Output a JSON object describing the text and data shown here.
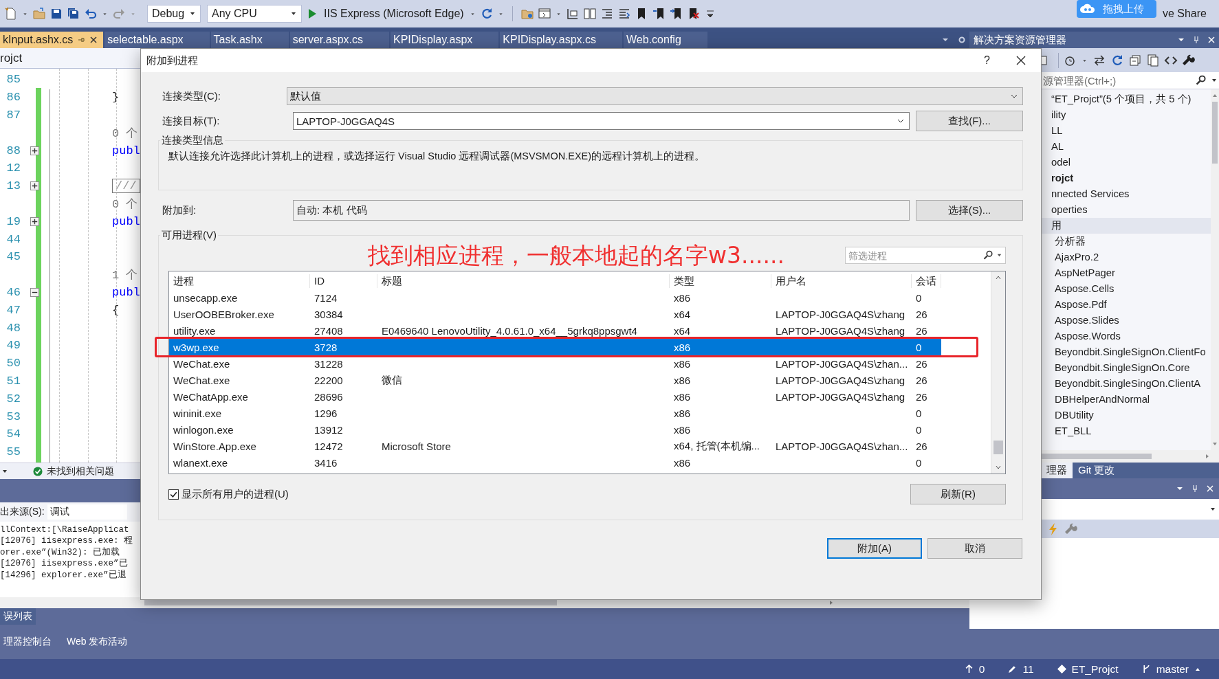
{
  "toolbar": {
    "configuration": "Debug",
    "platform": "Any CPU",
    "run_target": "IIS Express (Microsoft Edge)",
    "upload_button": "拖拽上传",
    "live_share": "ve Share"
  },
  "doc_tabs": [
    {
      "label": "kInput.ashx.cs",
      "selected": true
    },
    {
      "label": "selectable.aspx",
      "selected": false
    },
    {
      "label": "Task.ashx",
      "selected": false
    },
    {
      "label": "server.aspx.cs",
      "selected": false
    },
    {
      "label": "KPIDisplay.aspx",
      "selected": false
    },
    {
      "label": "KPIDisplay.aspx.cs",
      "selected": false
    },
    {
      "label": "Web.config",
      "selected": false
    }
  ],
  "editor": {
    "header": "rojct",
    "status": "未找到相关问题",
    "lines": [
      {
        "number": "85"
      },
      {
        "number": "86",
        "code": {
          "text": "}",
          "kind": "brace"
        }
      },
      {
        "number": "87"
      },
      {
        "code": {
          "text": "0 个",
          "kind": "lens"
        }
      },
      {
        "number": "88",
        "fold": {
          "expanded": false
        },
        "code": {
          "text": "publ",
          "kind": "keyword"
        }
      },
      {
        "number": "12"
      },
      {
        "number": "13",
        "fold": {
          "expanded": false
        },
        "code": {
          "text": "///",
          "kind": "block"
        }
      },
      {
        "code": {
          "text": "0 个",
          "kind": "lens"
        }
      },
      {
        "number": "19",
        "fold": {
          "expanded": false
        },
        "code": {
          "text": "publ",
          "kind": "keyword"
        }
      },
      {
        "number": "44"
      },
      {
        "number": "45"
      },
      {
        "code": {
          "text": "1 个",
          "kind": "lens"
        }
      },
      {
        "number": "46",
        "fold": {
          "expanded": true
        },
        "code": {
          "text": "publ",
          "kind": "keyword"
        }
      },
      {
        "number": "47",
        "code": {
          "text": "{",
          "kind": "brace"
        }
      },
      {
        "number": "48"
      },
      {
        "number": "49"
      },
      {
        "number": "50"
      },
      {
        "number": "51"
      },
      {
        "number": "52"
      },
      {
        "number": "53"
      },
      {
        "number": "54"
      },
      {
        "number": "55"
      }
    ]
  },
  "output": {
    "source_label": "出来源(S):",
    "source_value": "调试",
    "lines": [
      "llContext:[\\RaiseApplicat",
      "[12076] iisexpress.exe: 程",
      "orer.exe”(Win32): 已加载",
      "[12076] iisexpress.exe”已",
      "[14296] explorer.exe”已退"
    ]
  },
  "bottom_tabs": [
    {
      "tabs": [
        {
          "label": "误列表",
          "selected": true
        }
      ]
    },
    {
      "tabs": [
        {
          "label": "理器控制台",
          "selected": false
        },
        {
          "label": "Web 发布活动",
          "selected": false
        }
      ]
    }
  ],
  "status_bar": {
    "push": "0",
    "edits": "11",
    "repo": "ET_Projct",
    "branch": "master"
  },
  "solution_explorer": {
    "title": "解决方案资源管理器",
    "search_placeholder": "源管理器(Ctrl+;)",
    "tree": [
      {
        "label": "“ET_Projct”(5 个项目，共 5 个)",
        "selected": false,
        "children": [
          {
            "label": "ility",
            "selected": false
          },
          {
            "label": "LL",
            "selected": false
          },
          {
            "label": "AL",
            "selected": false
          },
          {
            "label": "odel",
            "selected": false
          },
          {
            "label": "rojct",
            "bold": true,
            "selected": false,
            "children": [
              {
                "label": "nnected Services",
                "selected": false
              },
              {
                "label": "operties",
                "selected": false
              },
              {
                "label": "用",
                "selected": true,
                "children": [
                  {
                    "label": "分析器",
                    "selected": false
                  },
                  {
                    "label": "AjaxPro.2",
                    "selected": false
                  },
                  {
                    "label": "AspNetPager",
                    "selected": false
                  },
                  {
                    "label": "Aspose.Cells",
                    "selected": false
                  },
                  {
                    "label": "Aspose.Pdf",
                    "selected": false
                  },
                  {
                    "label": "Aspose.Slides",
                    "selected": false
                  },
                  {
                    "label": "Aspose.Words",
                    "selected": false
                  },
                  {
                    "label": "Beyondbit.SingleSignOn.ClientFo",
                    "selected": false
                  },
                  {
                    "label": "Beyondbit.SingleSignOn.Core",
                    "selected": false
                  },
                  {
                    "label": "Beyondbit.SingleSingOn.ClientA",
                    "selected": false
                  },
                  {
                    "label": "DBHelperAndNormal",
                    "selected": false
                  },
                  {
                    "label": "DBUtility",
                    "selected": false
                  },
                  {
                    "label": "ET_BLL",
                    "selected": false
                  }
                ]
              }
            ]
          }
        ]
      }
    ],
    "tabs": [
      {
        "label": "理器",
        "selected": true
      },
      {
        "label": "Git 更改",
        "selected": false
      }
    ]
  },
  "dialog": {
    "title": "附加到进程",
    "help": "?",
    "connection_type": {
      "label": "连接类型(C):",
      "value": "默认值"
    },
    "connection_target": {
      "label": "连接目标(T):",
      "value": "LAPTOP-J0GGAQ4S",
      "button": "查找(F)..."
    },
    "info": {
      "title": "连接类型信息",
      "text": "默认连接允许选择此计算机上的进程，或选择运行 Visual Studio 远程调试器(MSVSMON.EXE)的远程计算机上的进程。"
    },
    "attach_to": {
      "label": "附加到:",
      "value": "自动: 本机 代码",
      "button": "选择(S)..."
    },
    "processes": {
      "title": "可用进程(V)",
      "filter_placeholder": "筛选进程",
      "columns": [
        "进程",
        "ID",
        "标题",
        "类型",
        "用户名",
        "会话"
      ],
      "rows": [
        {
          "cells": [
            "unsecapp.exe",
            "7124",
            "",
            "x86",
            "",
            "0"
          ],
          "selected": false
        },
        {
          "cells": [
            "UserOOBEBroker.exe",
            "30384",
            "",
            "x64",
            "LAPTOP-J0GGAQ4S\\zhang",
            "26"
          ],
          "selected": false
        },
        {
          "cells": [
            "utility.exe",
            "27408",
            "E0469640 LenovoUtility_4.0.61.0_x64__5grkq8ppsgwt4",
            "x64",
            "LAPTOP-J0GGAQ4S\\zhang",
            "26"
          ],
          "selected": false
        },
        {
          "cells": [
            "w3wp.exe",
            "3728",
            "",
            "x86",
            "",
            "0"
          ],
          "selected": true
        },
        {
          "cells": [
            "WeChat.exe",
            "31228",
            "",
            "x86",
            "LAPTOP-J0GGAQ4S\\zhan...",
            "26"
          ],
          "selected": false
        },
        {
          "cells": [
            "WeChat.exe",
            "22200",
            "微信",
            "x86",
            "LAPTOP-J0GGAQ4S\\zhang",
            "26"
          ],
          "selected": false
        },
        {
          "cells": [
            "WeChatApp.exe",
            "28696",
            "",
            "x86",
            "LAPTOP-J0GGAQ4S\\zhang",
            "26"
          ],
          "selected": false
        },
        {
          "cells": [
            "wininit.exe",
            "1296",
            "",
            "x86",
            "",
            "0"
          ],
          "selected": false
        },
        {
          "cells": [
            "winlogon.exe",
            "13912",
            "",
            "x86",
            "",
            "0"
          ],
          "selected": false
        },
        {
          "cells": [
            "WinStore.App.exe",
            "12472",
            "Microsoft Store",
            "x64, 托管(本机编...",
            "LAPTOP-J0GGAQ4S\\zhan...",
            "26"
          ],
          "selected": false
        },
        {
          "cells": [
            "wlanext.exe",
            "3416",
            "",
            "x86",
            "",
            "0"
          ],
          "selected": false
        }
      ]
    },
    "show_all_users": {
      "label": "显示所有用户的进程(U)",
      "checked": true
    },
    "refresh_button": "刷新(R)",
    "attach_button": "附加(A)",
    "cancel_button": "取消"
  },
  "annotation": {
    "text": "找到相应进程，一般本地起的名字w3......"
  }
}
